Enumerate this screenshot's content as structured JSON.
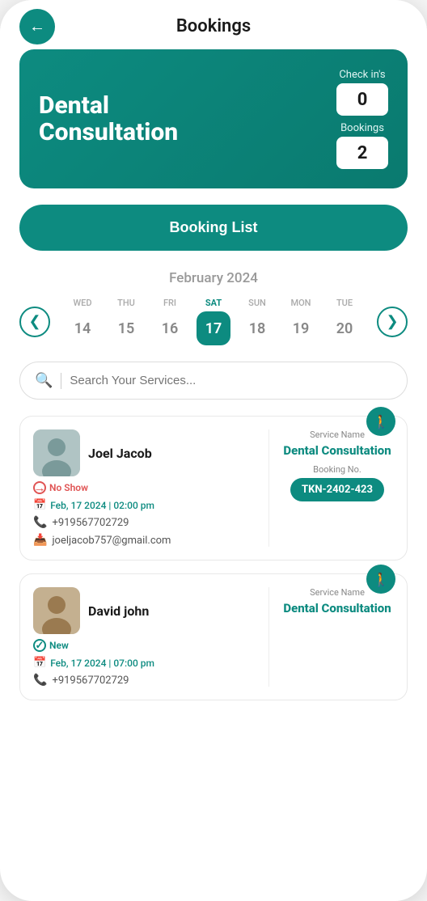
{
  "header": {
    "title": "Bookings",
    "back_label": "←"
  },
  "service_card": {
    "name": "Dental Consultation",
    "checkins_label": "Check in's",
    "checkins_value": "0",
    "bookings_label": "Bookings",
    "bookings_value": "2"
  },
  "booking_list_btn": "Booking List",
  "calendar": {
    "month": "February 2024",
    "days": [
      {
        "label": "WED",
        "num": "14",
        "active": false
      },
      {
        "label": "THU",
        "num": "15",
        "active": false
      },
      {
        "label": "FRI",
        "num": "16",
        "active": false
      },
      {
        "label": "SAT",
        "num": "17",
        "active": true
      },
      {
        "label": "SUN",
        "num": "18",
        "active": false
      },
      {
        "label": "MON",
        "num": "19",
        "active": false
      },
      {
        "label": "TUE",
        "num": "20",
        "active": false
      }
    ],
    "prev_label": "❮",
    "next_label": "❯"
  },
  "search": {
    "placeholder": "Search Your Services..."
  },
  "bookings": [
    {
      "patient_name": "Joel Jacob",
      "status": "No Show",
      "status_type": "no-show",
      "date_time": "Feb, 17 2024 | 02:00 pm",
      "phone": "+919567702729",
      "email": "joeljacob757@gmail.com",
      "service_label": "Service Name",
      "service_name": "Dental Consultation",
      "booking_no_label": "Booking No.",
      "booking_token": "TKN-2402-423"
    },
    {
      "patient_name": "David john",
      "status": "New",
      "status_type": "new",
      "date_time": "Feb, 17 2024 | 07:00 pm",
      "phone": "+919567702729",
      "email": "",
      "service_label": "Service Name",
      "service_name": "Dental Consultation",
      "booking_no_label": "",
      "booking_token": ""
    }
  ],
  "colors": {
    "primary": "#0d8b80",
    "no_show": "#e05454",
    "new": "#0d8b80"
  }
}
